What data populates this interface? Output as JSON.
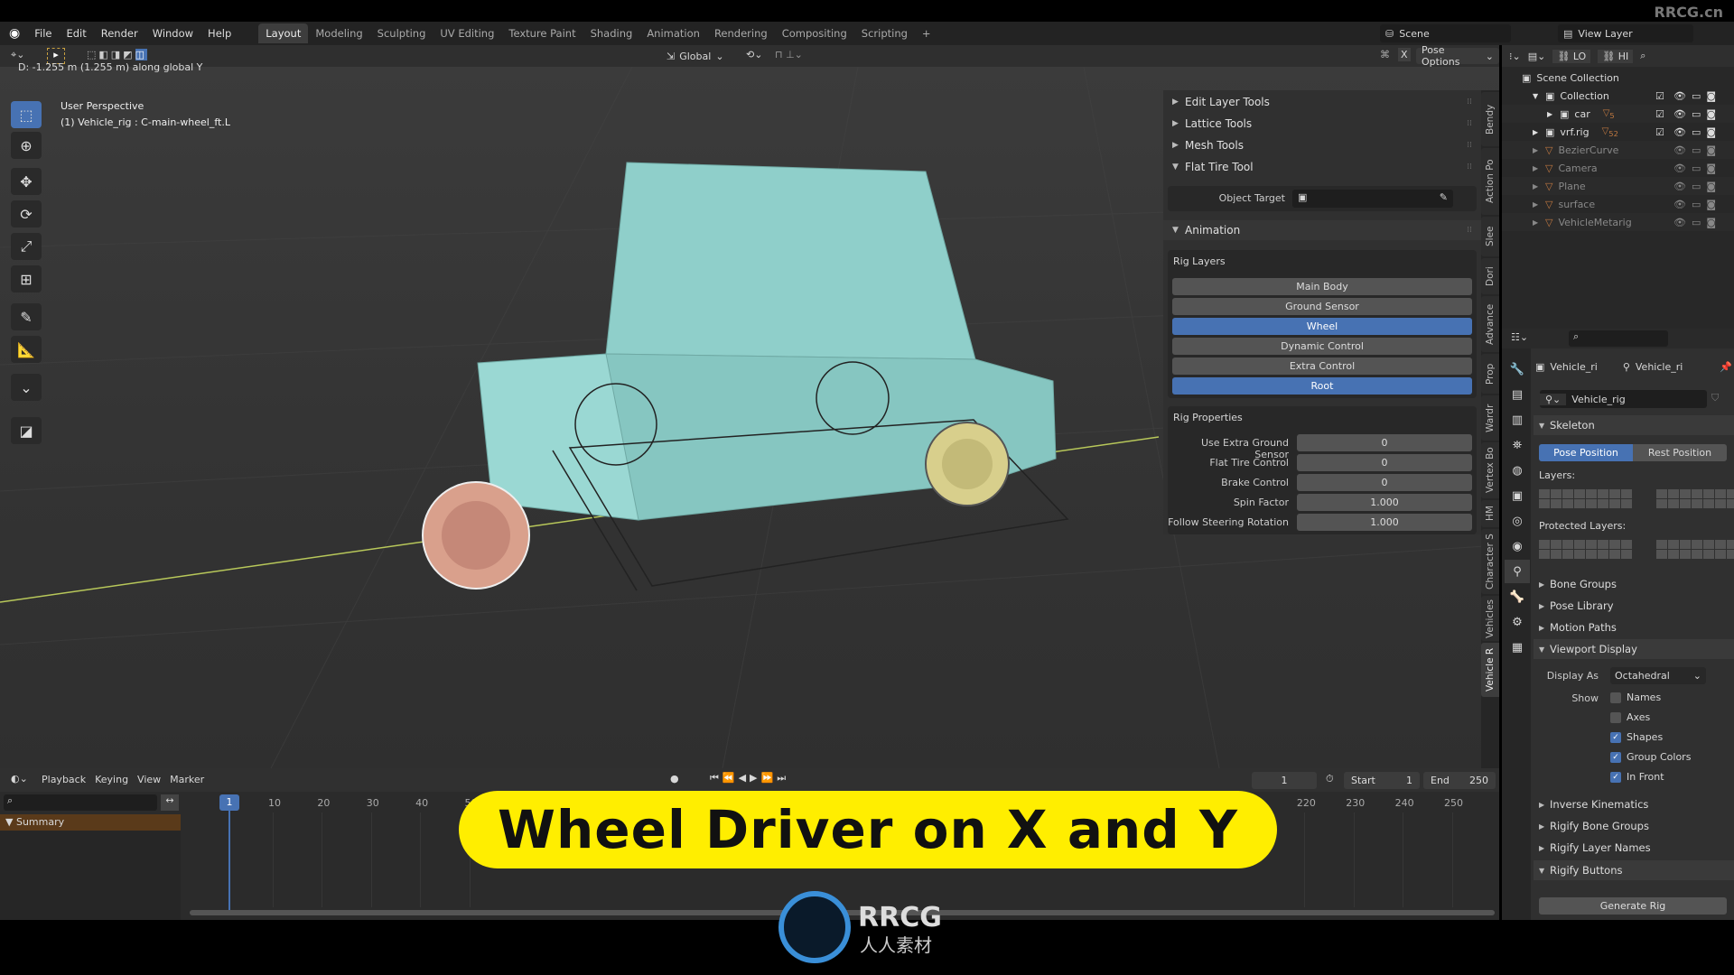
{
  "watermark": "RRCG.cn",
  "logo": {
    "text": "RRCG",
    "subtext": "人人素材"
  },
  "menu": [
    "File",
    "Edit",
    "Render",
    "Window",
    "Help"
  ],
  "workspaces": [
    {
      "label": "Layout",
      "active": true
    },
    {
      "label": "Modeling"
    },
    {
      "label": "Sculpting"
    },
    {
      "label": "UV Editing"
    },
    {
      "label": "Texture Paint"
    },
    {
      "label": "Shading"
    },
    {
      "label": "Animation"
    },
    {
      "label": "Rendering"
    },
    {
      "label": "Compositing"
    },
    {
      "label": "Scripting"
    },
    {
      "label": "+"
    }
  ],
  "scene": {
    "label": "Scene",
    "view_layer": "View Layer"
  },
  "header": {
    "orientation": "Global",
    "pose_options": "Pose Options",
    "x_mirror": "X",
    "lo": "LO",
    "hi": "HI"
  },
  "viewport": {
    "status": "D: -1.255 m (1.255 m) along global Y",
    "perspective": "User Perspective",
    "object": "(1) Vehicle_rig : C-main-wheel_ft.L",
    "colors": {
      "body": "#8fcfca",
      "front_wheel": "#d9a08c",
      "rear_wheel": "#d8cf8c",
      "axis_line": "#b8c85a"
    }
  },
  "tools": [
    "select-box-icon",
    "cursor-icon",
    "move-icon",
    "rotate-icon",
    "scale-icon",
    "transform-icon",
    "annotate-icon",
    "measure-icon",
    "bone-envelope-icon",
    "bone-roll-icon"
  ],
  "npanel": {
    "collapsed": [
      "Edit Layer Tools",
      "Lattice Tools",
      "Mesh Tools"
    ],
    "flat_tire": {
      "title": "Flat Tire Tool",
      "object_target_label": "Object Target",
      "object_target_value": ""
    },
    "animation": {
      "title": "Animation"
    },
    "rig_layers": {
      "title": "Rig Layers",
      "buttons": [
        {
          "label": "Main Body",
          "active": false
        },
        {
          "label": "Ground Sensor",
          "active": false
        },
        {
          "label": "Wheel",
          "active": true
        },
        {
          "label": "Dynamic Control",
          "active": false
        },
        {
          "label": "Extra Control",
          "active": false
        },
        {
          "label": "Root",
          "active": true
        }
      ]
    },
    "rig_properties": {
      "title": "Rig Properties",
      "rows": [
        {
          "label": "Use Extra Ground Sensor",
          "value": "0"
        },
        {
          "label": "Flat Tire Control",
          "value": "0"
        },
        {
          "label": "Brake Control",
          "value": "0"
        },
        {
          "label": "Spin Factor",
          "value": "1.000"
        },
        {
          "label": "Follow Steering Rotation",
          "value": "1.000"
        }
      ]
    },
    "tabs": [
      "Bendy",
      "Action Po",
      "Slee",
      "Dori",
      "Advance",
      "Prop",
      "Wardr",
      "Vertex Bo",
      "HM",
      "Character S",
      "Vehicles",
      "Vehicle R"
    ],
    "active_tab": "Vehicle R"
  },
  "outliner": {
    "root": "Scene Collection",
    "rows": [
      {
        "name": "Collection",
        "expanded": true,
        "dim": false,
        "checked": true
      },
      {
        "name": "car",
        "dim": false,
        "checked": true,
        "badge": "5"
      },
      {
        "name": "vrf.rig",
        "dim": false,
        "checked": true,
        "badge": "52"
      },
      {
        "name": "BezierCurve",
        "dim": true
      },
      {
        "name": "Camera",
        "dim": true
      },
      {
        "name": "Plane",
        "dim": true
      },
      {
        "name": "surface",
        "dim": true
      },
      {
        "name": "VehicleMetarig",
        "dim": true
      }
    ]
  },
  "properties": {
    "context": {
      "object": "Vehicle_ri",
      "armature": "Vehicle_ri"
    },
    "data_name": "Vehicle_rig",
    "skeleton": {
      "title": "Skeleton",
      "pose": "Pose Position",
      "rest": "Rest Position",
      "layers_label": "Layers:",
      "protected_label": "Protected Layers:"
    },
    "collapsed1": [
      "Bone Groups",
      "Pose Library",
      "Motion Paths"
    ],
    "viewport_display": {
      "title": "Viewport Display",
      "display_as_label": "Display As",
      "display_as": "Octahedral",
      "show_label": "Show",
      "options": [
        {
          "label": "Names",
          "checked": false
        },
        {
          "label": "Axes",
          "checked": false
        },
        {
          "label": "Shapes",
          "checked": true
        },
        {
          "label": "Group Colors",
          "checked": true
        },
        {
          "label": "In Front",
          "checked": true
        }
      ]
    },
    "collapsed2": [
      "Inverse Kinematics",
      "Rigify Bone Groups",
      "Rigify Layer Names"
    ],
    "rigify_buttons": {
      "title": "Rigify Buttons",
      "generate": "Generate Rig"
    }
  },
  "timeline": {
    "menus": [
      "Playback",
      "Keying",
      "View",
      "Marker"
    ],
    "current_frame": "1",
    "start_label": "Start",
    "start": "1",
    "end_label": "End",
    "end": "250",
    "ticks": [
      "10",
      "20",
      "30",
      "40",
      "50",
      "220",
      "230",
      "240",
      "250"
    ],
    "summary": "Summary"
  },
  "banner": "Wheel Driver on X and Y"
}
